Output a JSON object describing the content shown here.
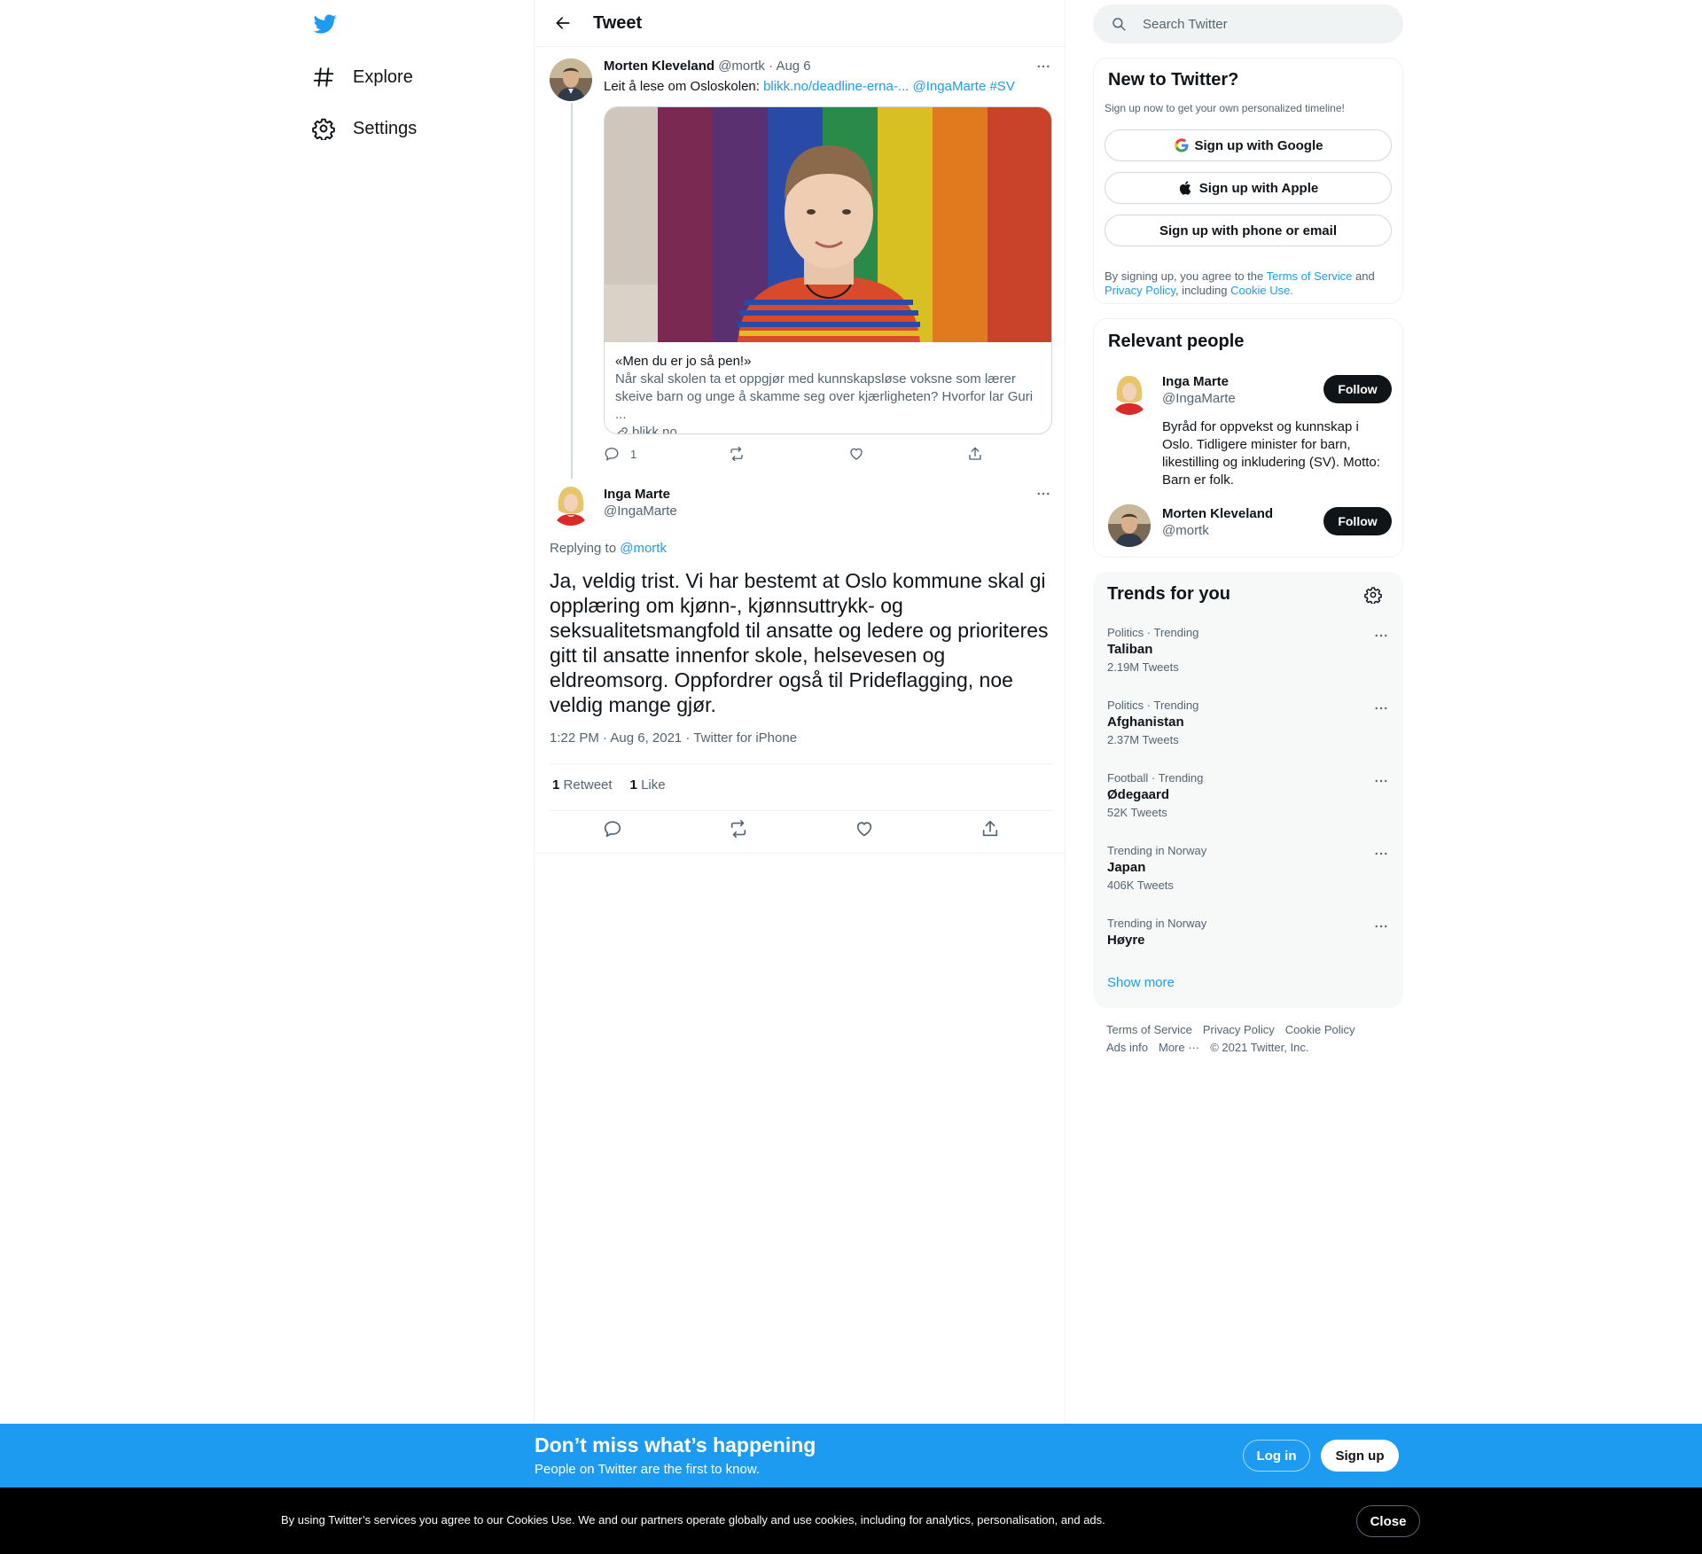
{
  "nav": {
    "explore_label": "Explore",
    "settings_label": "Settings"
  },
  "header": {
    "title": "Tweet"
  },
  "parent_tweet": {
    "author_name": "Morten Kleveland",
    "author_handle": "@mortk",
    "date": "· Aug 6",
    "text_prefix": "Leit å lese om Osloskolen: ",
    "link": "blikk.no/deadline-erna-...",
    "mention": "@IngaMarte",
    "hashtag": "#SV",
    "card": {
      "title": "«Men du er jo så pen!»",
      "description": "Når skal skolen ta et oppgjør med kunnskapsløse voksne som lærer skeive barn og unge å skamme seg over kjærligheten? Hvorfor lar Guri ...",
      "domain": "blikk.no"
    },
    "reply_count": "1"
  },
  "main_tweet": {
    "author_name": "Inga Marte",
    "author_handle": "@IngaMarte",
    "replying_prefix": "Replying to ",
    "replying_to": "@mortk",
    "text": "Ja, veldig trist. Vi har bestemt at Oslo kommune skal gi opplæring om kjønn-, kjønnsuttrykk- og seksualitetsmangfold til ansatte og ledere og prioriteres gitt til ansatte innenfor skole, helsevesen og eldreomsorg. Oppfordrer også til Prideflagging, noe veldig mange gjør.",
    "timestamp": "1:22 PM · Aug 6, 2021 · Twitter for iPhone",
    "retweets_count": "1",
    "retweets_label": "Retweet",
    "likes_count": "1",
    "likes_label": "Like"
  },
  "search": {
    "placeholder": "Search Twitter"
  },
  "signup_box": {
    "title": "New to Twitter?",
    "subtitle": "Sign up now to get your own personalized timeline!",
    "google_label": "Sign up with Google",
    "apple_label": "Sign up with Apple",
    "phone_label": "Sign up with phone or email",
    "legal_1": "By signing up, you agree to the ",
    "terms": "Terms of Service",
    "legal_2": " and ",
    "privacy": "Privacy Policy",
    "legal_3": ", including ",
    "cookie": "Cookie Use."
  },
  "relevant_people": {
    "title": "Relevant people",
    "people": [
      {
        "name": "Inga Marte",
        "handle": "@IngaMarte",
        "bio": "Byråd for oppvekst og kunnskap i Oslo. Tidligere minister for barn, likestilling og inkludering (SV). Motto: Barn er folk.",
        "follow_label": "Follow"
      },
      {
        "name": "Morten Kleveland",
        "handle": "@mortk",
        "follow_label": "Follow"
      }
    ]
  },
  "trends": {
    "title": "Trends for you",
    "items": [
      {
        "context": "Politics · Trending",
        "name": "Taliban",
        "count": "2.19M Tweets"
      },
      {
        "context": "Politics · Trending",
        "name": "Afghanistan",
        "count": "2.37M Tweets"
      },
      {
        "context": "Football · Trending",
        "name": "Ødegaard",
        "count": "52K Tweets"
      },
      {
        "context": "Trending in Norway",
        "name": "Japan",
        "count": "406K Tweets"
      },
      {
        "context": "Trending in Norway",
        "name": "Høyre",
        "count": ""
      }
    ],
    "show_more": "Show more"
  },
  "footer": {
    "terms": "Terms of Service",
    "privacy": "Privacy Policy",
    "cookie": "Cookie Policy",
    "ads": "Ads info",
    "more": "More ···",
    "copyright": "© 2021 Twitter, Inc."
  },
  "bottom_bar": {
    "title": "Don’t miss what’s happening",
    "subtitle": "People on Twitter are the first to know.",
    "login_label": "Log in",
    "signup_label": "Sign up"
  },
  "cookie_bar": {
    "text": "By using Twitter’s services you agree to our Cookies Use. We and our partners operate globally and use cookies, including for analytics, personalisation, and ads.",
    "close_label": "Close"
  },
  "colors": {
    "brand": "#1d9bf0",
    "text": "#0f1419",
    "secondary": "#536471",
    "border": "#eff3f4",
    "cookie_bar_bg": "#000000"
  },
  "icons": [
    "twitter-logo-icon",
    "hashtag-icon",
    "gear-icon",
    "back-arrow-icon",
    "more-icon",
    "reply-icon",
    "retweet-icon",
    "like-icon",
    "share-icon",
    "search-icon",
    "google-icon",
    "apple-icon",
    "link-icon"
  ]
}
